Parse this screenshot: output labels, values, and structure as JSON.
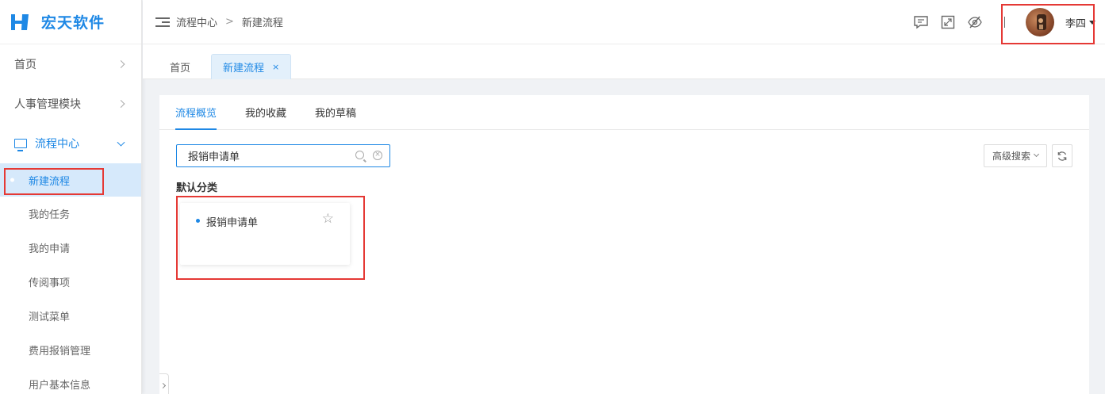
{
  "brand": {
    "name": "宏天软件",
    "color": "#1e88e5"
  },
  "sidebar": {
    "items": [
      {
        "label": "首页",
        "icon": "chevron-right-icon"
      },
      {
        "label": "人事管理模块",
        "icon": "chevron-right-icon"
      },
      {
        "label": "流程中心",
        "icon": "monitor-icon",
        "expanded": true
      }
    ],
    "sub_items": [
      {
        "label": "新建流程",
        "active": true
      },
      {
        "label": "我的任务"
      },
      {
        "label": "我的申请"
      },
      {
        "label": "传阅事项"
      },
      {
        "label": "测试菜单"
      },
      {
        "label": "费用报销管理"
      },
      {
        "label": "用户基本信息"
      }
    ]
  },
  "header": {
    "breadcrumb": [
      "流程中心",
      "新建流程"
    ],
    "breadcrumb_separator": ">",
    "icons": [
      "message-icon",
      "fullscreen-icon",
      "eye-off-icon"
    ],
    "user": {
      "name": "李四"
    }
  },
  "page_tabs": [
    {
      "label": "首页"
    },
    {
      "label": "新建流程",
      "active": true,
      "close": "×"
    }
  ],
  "content": {
    "tabs": [
      "流程概览",
      "我的收藏",
      "我的草稿"
    ],
    "active_tab": "流程概览",
    "search": {
      "value": "报销申请单"
    },
    "advanced_search_label": "高级搜索",
    "category_title": "默认分类",
    "cards": [
      {
        "title": "报销申请单",
        "icon": "star-icon"
      }
    ]
  },
  "colors": {
    "highlight_box": "#e53935",
    "active_bg": "#d6e9fb"
  }
}
